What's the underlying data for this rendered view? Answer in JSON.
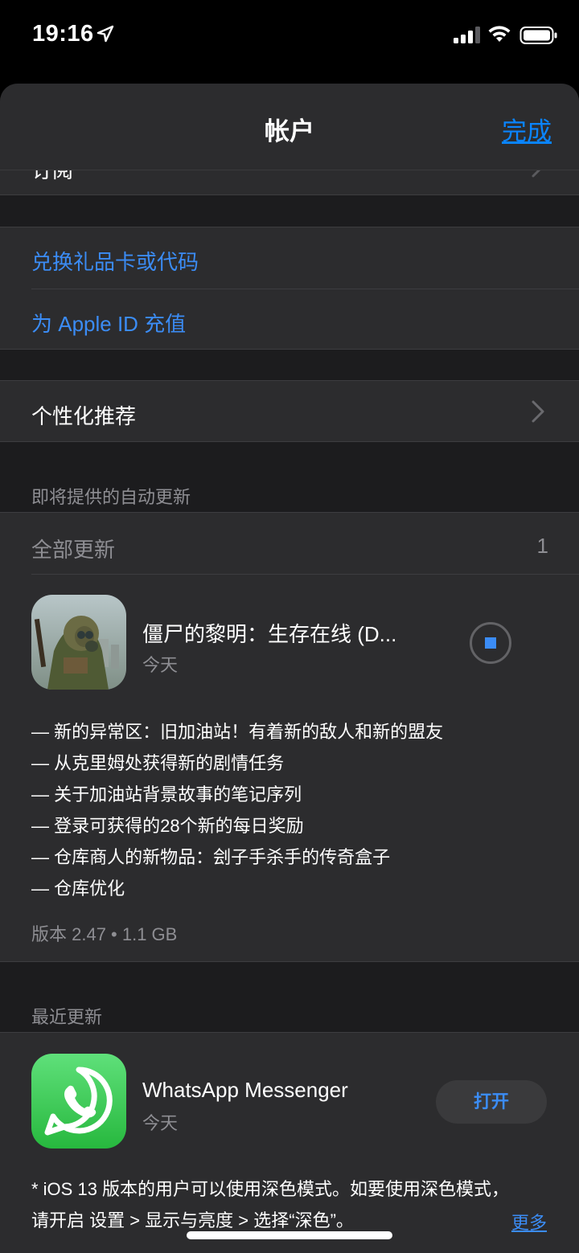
{
  "status_bar": {
    "time": "19:16"
  },
  "nav": {
    "title": "帐户",
    "done_label": "完成"
  },
  "partial_row": {
    "label": "订阅"
  },
  "links": [
    {
      "label": "兑换礼品卡或代码"
    },
    {
      "label": "为 Apple ID 充值"
    }
  ],
  "personalized": {
    "label": "个性化推荐"
  },
  "pending_updates": {
    "header": "即将提供的自动更新",
    "update_all_label": "全部更新",
    "count": "1",
    "app": {
      "name": "僵尸的黎明：生存在线 (D...",
      "date": "今天",
      "notes": [
        "— 新的异常区：旧加油站！有着新的敌人和新的盟友",
        "— 从克里姆处获得新的剧情任务",
        "— 关于加油站背景故事的笔记序列",
        "— 登录可获得的28个新的每日奖励",
        "— 仓库商人的新物品：刽子手杀手的传奇盒子",
        "— 仓库优化"
      ],
      "version_info": "版本 2.47 • 1.1 GB"
    }
  },
  "recent_updates": {
    "header": "最近更新",
    "app": {
      "name": "WhatsApp Messenger",
      "date": "今天",
      "open_label": "打开",
      "note_line1": "* iOS 13 版本的用户可以使用深色模式。如要使用深色模式，",
      "note_line2": "请开启 设置 > 显示与亮度 > 选择“深色”。",
      "more_label": "更多"
    }
  },
  "colors": {
    "accent": "#3b8cf5",
    "background": "#1c1c1e",
    "cell": "#2c2c2e",
    "secondary_text": "#8e8e93"
  }
}
